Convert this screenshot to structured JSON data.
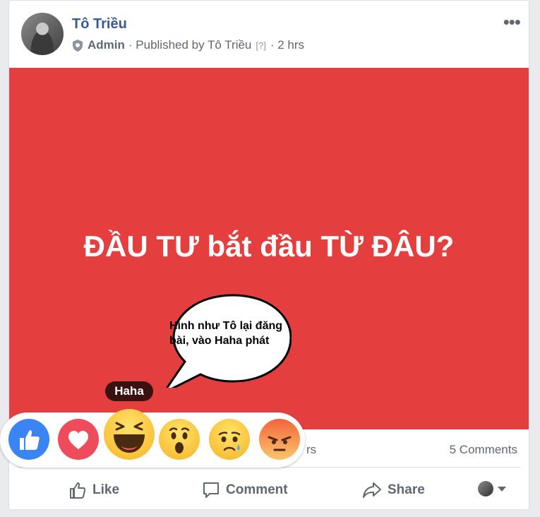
{
  "post": {
    "author": "Tô Triều",
    "role": "Admin",
    "published_prefix": "· Published by Tô Triều",
    "unknown_marker": "[?]",
    "time": "· 2 hrs",
    "more_glyph": "•••"
  },
  "hero": {
    "text": "ĐẦU TƯ bắt đầu TỪ ĐÂU?",
    "background_color": "#e43f3e"
  },
  "annotation": {
    "bubble_text": "Hình như Tô lại đăng bài, vào Haha phát"
  },
  "reaction_picker": {
    "hovered_label": "Haha",
    "items": [
      {
        "name": "Like",
        "icon": "like-icon"
      },
      {
        "name": "Love",
        "icon": "love-icon"
      },
      {
        "name": "Haha",
        "icon": "haha-icon"
      },
      {
        "name": "Wow",
        "icon": "wow-icon"
      },
      {
        "name": "Sad",
        "icon": "sad-icon"
      },
      {
        "name": "Angry",
        "icon": "angry-icon"
      }
    ]
  },
  "stats": {
    "partial_text": "rs",
    "comments": "5 Comments"
  },
  "actions": {
    "like": "Like",
    "comment": "Comment",
    "share": "Share"
  },
  "colors": {
    "link": "#385898",
    "muted": "#616770",
    "like_blue": "#3b84f4",
    "love_red": "#ee4b5b",
    "tooltip_bg": "#3b1010"
  }
}
